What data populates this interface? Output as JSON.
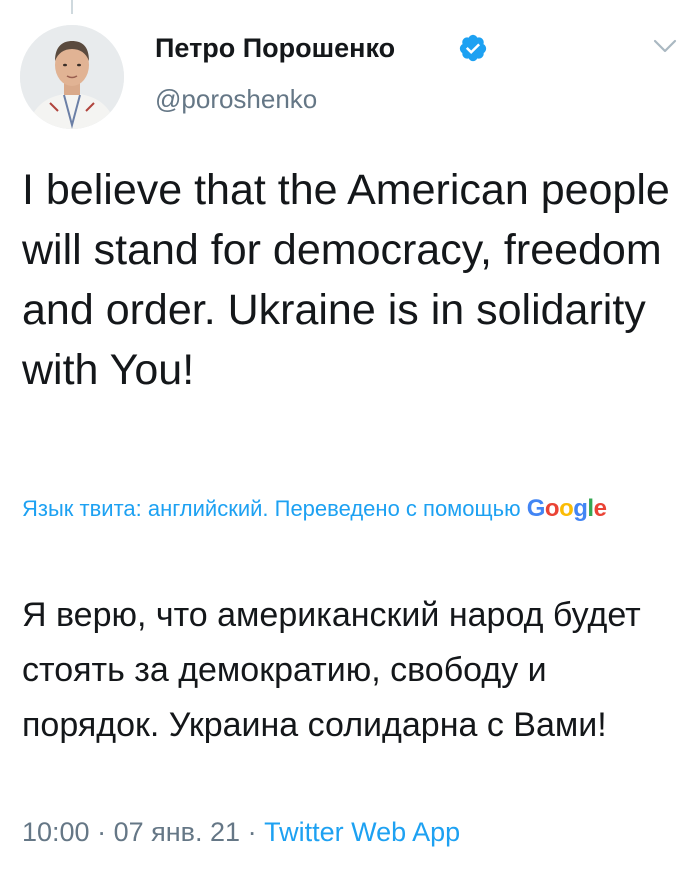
{
  "author": {
    "name": "Петро Порошенко",
    "handle": "@poroshenko",
    "verified": true
  },
  "tweet": {
    "text": "I believe that the American people will stand for democracy, freedom and order. Ukraine is in solidarity with You!"
  },
  "translation": {
    "note": "Язык твита: английский. Переведено с помощью",
    "provider": "Google",
    "text": "Я верю, что американский народ будет стоять за демократию, свободу и порядок. Украина солидарна с Вами!"
  },
  "meta": {
    "time": "10:00",
    "separator": "·",
    "date": "07 янв. 21",
    "source": "Twitter Web App"
  },
  "colors": {
    "link": "#1da1f2",
    "secondary_text": "#657786",
    "verified": "#1da1f2"
  },
  "icons": {
    "verified": "verified-badge-icon",
    "caret": "chevron-down-icon"
  }
}
